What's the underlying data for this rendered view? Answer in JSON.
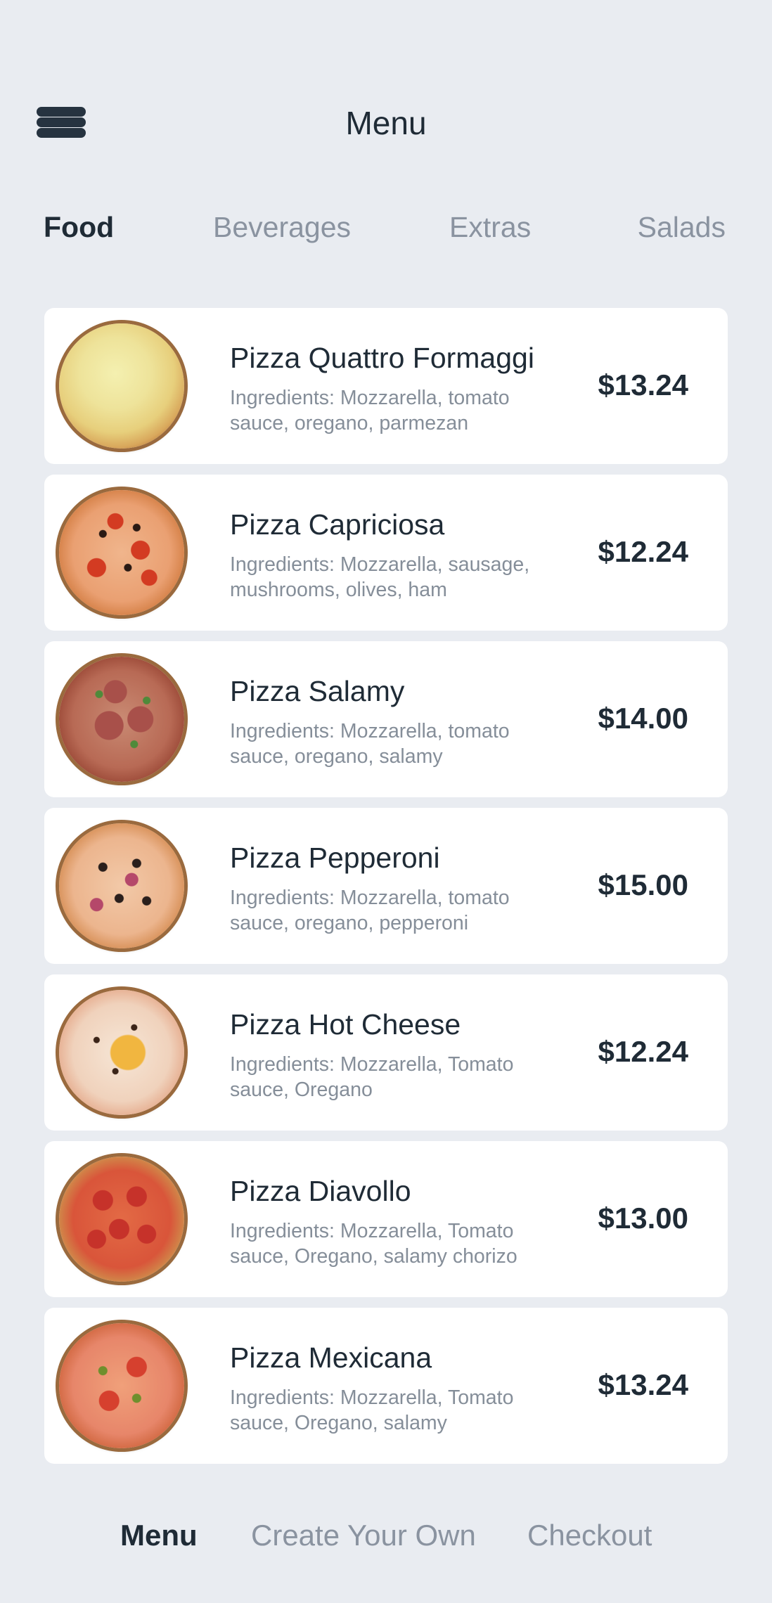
{
  "header": {
    "title": "Menu",
    "menu_icon": "hamburger-menu-icon"
  },
  "tabs": [
    {
      "label": "Food",
      "active": true
    },
    {
      "label": "Beverages",
      "active": false
    },
    {
      "label": "Extras",
      "active": false
    },
    {
      "label": "Salads",
      "active": false
    }
  ],
  "items": [
    {
      "name": "Pizza Quattro Formaggi",
      "ingredients": "Ingredients: Mozzarella, tomato sauce, oregano, parmezan",
      "price": "$13.24",
      "image": "quattro-formaggi-pizza-image"
    },
    {
      "name": "Pizza Capriciosa",
      "ingredients": "Ingredients: Mozzarella, sausage, mushrooms, olives, ham",
      "price": "$12.24",
      "image": "capriciosa-pizza-image"
    },
    {
      "name": "Pizza Salamy",
      "ingredients": "Ingredients: Mozzarella, tomato sauce, oregano, salamy",
      "price": "$14.00",
      "image": "salamy-pizza-image"
    },
    {
      "name": "Pizza Pepperoni",
      "ingredients": "Ingredients: Mozzarella, tomato sauce, oregano, pepperoni",
      "price": "$15.00",
      "image": "pepperoni-pizza-image"
    },
    {
      "name": "Pizza Hot Cheese",
      "ingredients": "Ingredients: Mozzarella, Tomato sauce, Oregano",
      "price": "$12.24",
      "image": "hot-cheese-pizza-image"
    },
    {
      "name": "Pizza Diavollo",
      "ingredients": "Ingredients: Mozzarella, Tomato sauce, Oregano, salamy chorizo",
      "price": "$13.00",
      "image": "diavollo-pizza-image"
    },
    {
      "name": "Pizza Mexicana",
      "ingredients": "Ingredients: Mozzarella, Tomato sauce, Oregano, salamy",
      "price": "$13.24",
      "image": "mexicana-pizza-image"
    }
  ],
  "bottom_nav": [
    {
      "label": "Menu",
      "active": true
    },
    {
      "label": "Create Your Own",
      "active": false
    },
    {
      "label": "Checkout",
      "active": false
    }
  ],
  "colors": {
    "background": "#e9ecf1",
    "card": "#ffffff",
    "text_primary": "#1f2b36",
    "text_muted": "#8a93a0"
  }
}
